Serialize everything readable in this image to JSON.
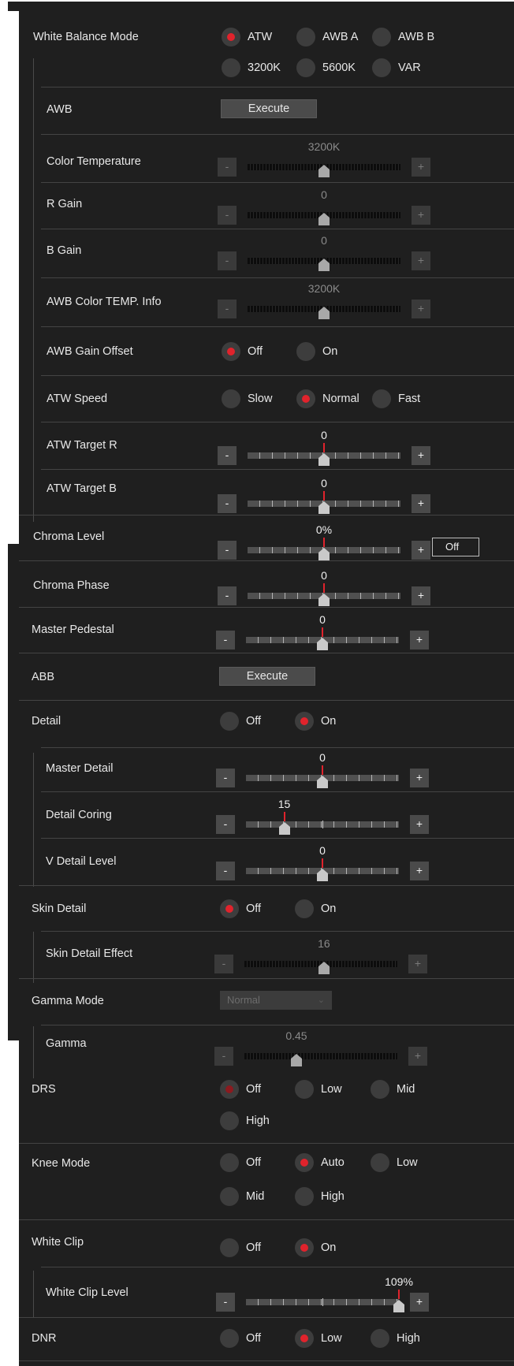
{
  "white_balance_mode": {
    "label": "White Balance Mode",
    "options": [
      "ATW",
      "AWB A",
      "AWB B",
      "3200K",
      "5600K",
      "VAR"
    ],
    "selected": "ATW"
  },
  "awb": {
    "label": "AWB",
    "button": "Execute"
  },
  "color_temperature": {
    "label": "Color Temperature",
    "value": "3200K",
    "level": 0.5,
    "enabled": false
  },
  "r_gain": {
    "label": "R Gain",
    "value": "0",
    "level": 0.5,
    "enabled": false
  },
  "b_gain": {
    "label": "B Gain",
    "value": "0",
    "level": 0.5,
    "enabled": false
  },
  "awb_color_temp_info": {
    "label": "AWB Color TEMP. Info",
    "value": "3200K",
    "level": 0.5,
    "enabled": false
  },
  "awb_gain_offset": {
    "label": "AWB Gain Offset",
    "options": [
      "Off",
      "On"
    ],
    "selected": "Off"
  },
  "atw_speed": {
    "label": "ATW Speed",
    "options": [
      "Slow",
      "Normal",
      "Fast"
    ],
    "selected": "Normal"
  },
  "atw_target_r": {
    "label": "ATW Target R",
    "value": "0",
    "level": 0.5
  },
  "atw_target_b": {
    "label": "ATW Target B",
    "value": "0",
    "level": 0.5
  },
  "chroma_level": {
    "label": "Chroma Level",
    "value": "0%",
    "level": 0.5,
    "toggle": "Off"
  },
  "chroma_phase": {
    "label": "Chroma Phase",
    "value": "0",
    "level": 0.5
  },
  "master_pedestal": {
    "label": "Master Pedestal",
    "value": "0",
    "level": 0.5
  },
  "abb": {
    "label": "ABB",
    "button": "Execute"
  },
  "detail": {
    "label": "Detail",
    "options": [
      "Off",
      "On"
    ],
    "selected": "On"
  },
  "master_detail": {
    "label": "Master Detail",
    "value": "0",
    "level": 0.5
  },
  "detail_coring": {
    "label": "Detail Coring",
    "value": "15",
    "level": 0.25
  },
  "v_detail_level": {
    "label": "V Detail Level",
    "value": "0",
    "level": 0.5
  },
  "skin_detail": {
    "label": "Skin Detail",
    "options": [
      "Off",
      "On"
    ],
    "selected": "Off"
  },
  "skin_detail_effect": {
    "label": "Skin Detail Effect",
    "value": "16",
    "level": 0.52,
    "enabled": false
  },
  "gamma_mode": {
    "label": "Gamma Mode",
    "value": "Normal",
    "enabled": false
  },
  "gamma": {
    "label": "Gamma",
    "value": "0.45",
    "level": 0.34,
    "enabled": false
  },
  "drs": {
    "label": "DRS",
    "options": [
      "Off",
      "Low",
      "Mid",
      "High"
    ],
    "selected": "Off"
  },
  "knee_mode": {
    "label": "Knee Mode",
    "options": [
      "Off",
      "Auto",
      "Low",
      "Mid",
      "High"
    ],
    "selected": "Auto"
  },
  "white_clip": {
    "label": "White Clip",
    "options": [
      "Off",
      "On"
    ],
    "selected": "On"
  },
  "white_clip_level": {
    "label": "White Clip Level",
    "value": "109%",
    "level": 1.0
  },
  "dnr": {
    "label": "DNR",
    "options": [
      "Off",
      "Low",
      "High"
    ],
    "selected": "Low"
  },
  "colors": {
    "panel_bg": "#1f1f1f",
    "radio_selected": "#e0232c",
    "divider": "#444444"
  }
}
